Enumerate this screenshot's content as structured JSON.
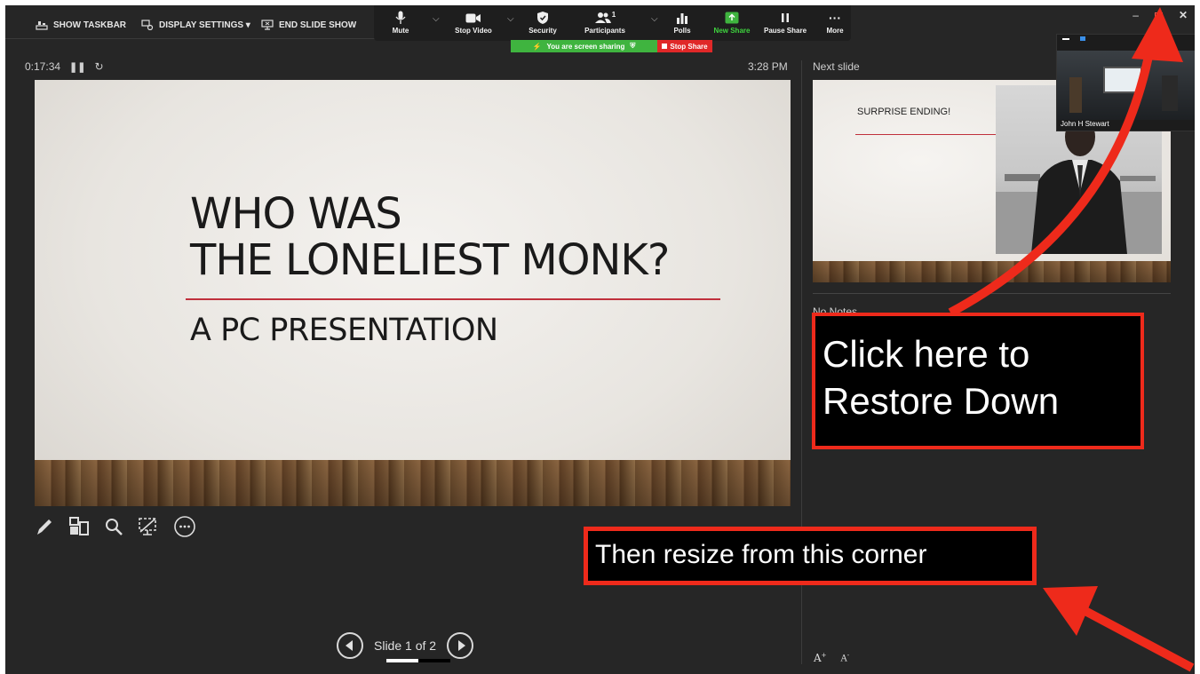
{
  "toolbar": {
    "show_taskbar": "SHOW TASKBAR",
    "display_settings": "DISPLAY SETTINGS ▾",
    "end_slide_show": "END SLIDE SHOW"
  },
  "zoom_bar": {
    "mute": "Mute",
    "stop_video": "Stop Video",
    "security": "Security",
    "participants": "Participants",
    "participants_count": "1",
    "polls": "Polls",
    "new_share": "New Share",
    "pause_share": "Pause Share",
    "more": "More",
    "more_glyph": "···",
    "new_share_color": "#3fb43f"
  },
  "share_banner": {
    "sharing_text": "You are screen sharing",
    "stop_share": "Stop Share"
  },
  "presenter": {
    "elapsed": "0:17:34",
    "clock": "3:28 PM",
    "next_slide_label": "Next slide",
    "no_notes": "No Notes",
    "slide_counter": "Slide 1 of 2",
    "slide_progress": 0.5,
    "font_increase": "A",
    "font_decrease": "A"
  },
  "current_slide": {
    "title_line1": "WHO WAS",
    "title_line2": "THE LONELIEST MONK?",
    "subtitle": "A PC PRESENTATION",
    "accent_color": "#c0303c"
  },
  "next_slide": {
    "title": "SURPRISE ENDING!"
  },
  "video_thumbnail": {
    "name": "John H Stewart"
  },
  "annotations": {
    "callout_restore": "Click here to Restore Down",
    "callout_resize": "Then resize from this corner",
    "arrow_color": "#ee2a1b"
  }
}
